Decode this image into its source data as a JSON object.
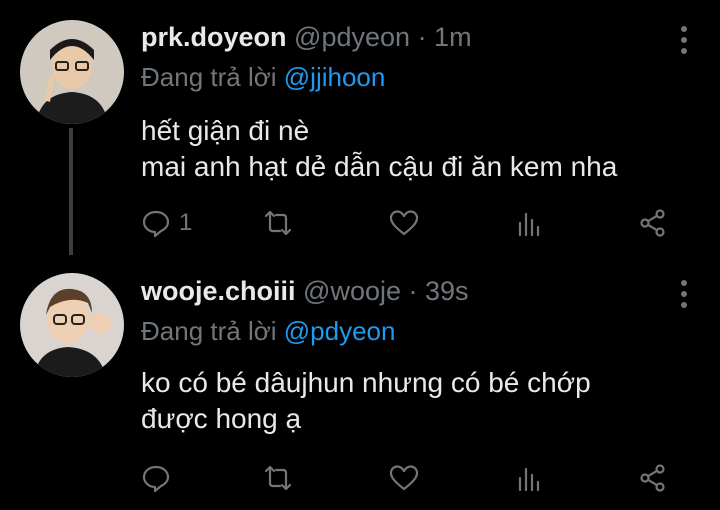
{
  "tweets": [
    {
      "display_name": "prk.doyeon",
      "handle": "@pdyeon",
      "time": "· 1m",
      "reply_prefix": "Đang trả lời ",
      "reply_to": "@jjihoon",
      "text_lines": [
        "hết giận đi nè",
        "mai anh hạt dẻ dẫn cậu đi ăn kem nha"
      ],
      "reply_count": "1",
      "actions": [
        "reply-icon",
        "retweet-icon",
        "like-icon",
        "stats-icon",
        "share-icon"
      ]
    },
    {
      "display_name": "wooje.choiii",
      "handle": "@wooje",
      "time": "· 39s",
      "reply_prefix": "Đang trả lời ",
      "reply_to": "@pdyeon",
      "text_lines": [
        "ko có bé dâujhun nhưng có bé chớp",
        "được hong ạ"
      ],
      "reply_count": "",
      "actions": [
        "reply-icon",
        "retweet-icon",
        "like-icon",
        "stats-icon",
        "share-icon"
      ]
    }
  ],
  "colors": {
    "background": "#000000",
    "text": "#e7e9ea",
    "muted": "#71767b",
    "link": "#1d9bf0",
    "thread": "#3a3d41"
  }
}
